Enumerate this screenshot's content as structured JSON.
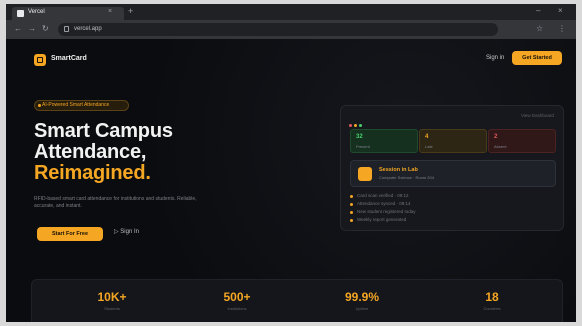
{
  "browser": {
    "tab_title": "Vercel",
    "tab_close": "×",
    "new_tab": "+",
    "window_min": "–",
    "window_close": "×",
    "url": "vercel.app",
    "nav_back": "←",
    "nav_forward": "→",
    "nav_reload": "↻",
    "ext1": "☆",
    "ext2": "⋮"
  },
  "nav": {
    "brand": "SmartCard",
    "signin": "Sign in",
    "cta": "Get Started"
  },
  "hero": {
    "badge": "AI-Powered Smart Attendance",
    "title_line1": "Smart Campus",
    "title_line2": "Attendance,",
    "title_line3": "Reimagined.",
    "subtitle": "RFID-based smart card attendance for institutions and students. Reliable, accurate, and instant.",
    "primary_button": "Start For Free",
    "secondary_button": "▷ Sign In"
  },
  "dashboard": {
    "dot_colors": [
      "#e05a5a",
      "#f5a623",
      "#47d16c"
    ],
    "link": "View Dashboard",
    "stats": [
      {
        "value": "32",
        "label": "Present"
      },
      {
        "value": "4",
        "label": "Late"
      },
      {
        "value": "2",
        "label": "Absent"
      }
    ],
    "session_title": "Session in Lab",
    "session_sub": "Computer Science · Room 204",
    "list": [
      "Card scan verified · 09:12",
      "Attendance synced · 09:14",
      "New student registered today",
      "Weekly report generated"
    ]
  },
  "metrics": [
    {
      "value": "10K+",
      "label": "Students"
    },
    {
      "value": "500+",
      "label": "Institutions"
    },
    {
      "value": "99.9%",
      "label": "Uptime"
    },
    {
      "value": "18",
      "label": "Countries"
    }
  ],
  "colors": {
    "accent": "#f5a623",
    "background": "#0c0d10",
    "present": "#47d16c",
    "absent": "#e05a5a"
  }
}
